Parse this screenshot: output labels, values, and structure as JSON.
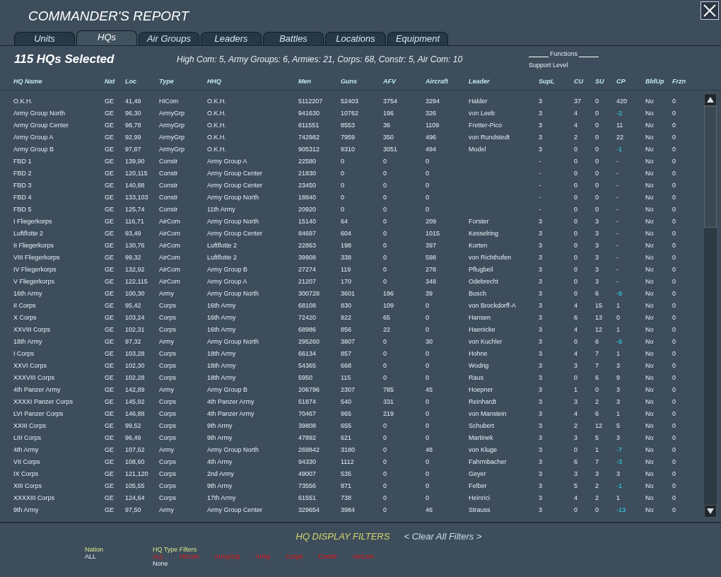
{
  "window": {
    "title": "COMMANDER'S REPORT"
  },
  "tabs": [
    {
      "label": "Units",
      "selected": false
    },
    {
      "label": "HQs",
      "selected": true
    },
    {
      "label": "Air Groups",
      "selected": false
    },
    {
      "label": "Leaders",
      "selected": false
    },
    {
      "label": "Battles",
      "selected": false
    },
    {
      "label": "Locations",
      "selected": false
    },
    {
      "label": "Equipment",
      "selected": false
    }
  ],
  "summary": {
    "count": "115 HQs Selected",
    "breakdown": "High Com: 5, Army Groups: 6, Armies: 21, Corps: 68, Constr: 5, Air Com: 10",
    "functions": "Functions",
    "support_level": "Support Level"
  },
  "table": {
    "columns": [
      "HQ Name",
      "Nat",
      "Loc",
      "Type",
      "HHQ",
      "Men",
      "Guns",
      "AFV",
      "Aircraft",
      "Leader",
      "SupL",
      "CU",
      "SU",
      "CP",
      "BldUp",
      "Frzn"
    ],
    "rows": [
      {
        "cells": [
          "O.K.H.",
          "GE",
          "41,49",
          "HiCom",
          "O.K.H.",
          "5112207",
          "52403",
          "3754",
          "3294",
          "Halder",
          "3",
          "37",
          "0",
          "420",
          "No",
          "0"
        ],
        "cp_alert": false
      },
      {
        "cells": [
          "Army Group North",
          "GE",
          "96,30",
          "ArmyGrp",
          "O.K.H.",
          "941630",
          "10762",
          "196",
          "326",
          "von Leeb",
          "3",
          "4",
          "0",
          "-2",
          "No",
          "0"
        ],
        "cp_alert": true
      },
      {
        "cells": [
          "Army Group Center",
          "GE",
          "98,78",
          "ArmyGrp",
          "O.K.H.",
          "811551",
          "8553",
          "36",
          "1109",
          "Fretter-Pico",
          "3",
          "4",
          "0",
          "11",
          "No",
          "0"
        ],
        "cp_alert": false
      },
      {
        "cells": [
          "Army Group A",
          "GE",
          "92,99",
          "ArmyGrp",
          "O.K.H.",
          "742982",
          "7959",
          "350",
          "496",
          "von Rundstedt",
          "3",
          "2",
          "0",
          "22",
          "No",
          "0"
        ],
        "cp_alert": false
      },
      {
        "cells": [
          "Army Group B",
          "GE",
          "97,87",
          "ArmyGrp",
          "O.K.H.",
          "905312",
          "9310",
          "3051",
          "494",
          "Model",
          "3",
          "0",
          "0",
          "-1",
          "No",
          "0"
        ],
        "cp_alert": true
      },
      {
        "cells": [
          "FBD 1",
          "GE",
          "139,90",
          "Constr",
          "Army Group A",
          "22580",
          "0",
          "0",
          "0",
          "",
          "-",
          "0",
          "0",
          "-",
          "No",
          "0"
        ],
        "cp_alert": false
      },
      {
        "cells": [
          "FBD 2",
          "GE",
          "120,115",
          "Constr",
          "Army Group Center",
          "21830",
          "0",
          "0",
          "0",
          "",
          "-",
          "0",
          "0",
          "-",
          "No",
          "0"
        ],
        "cp_alert": false
      },
      {
        "cells": [
          "FBD 3",
          "GE",
          "140,88",
          "Constr",
          "Army Group Center",
          "23450",
          "0",
          "0",
          "0",
          "",
          "-",
          "0",
          "0",
          "-",
          "No",
          "0"
        ],
        "cp_alert": false
      },
      {
        "cells": [
          "FBD 4",
          "GE",
          "133,103",
          "Constr",
          "Army Group North",
          "18840",
          "0",
          "0",
          "0",
          "",
          "-",
          "0",
          "0",
          "-",
          "No",
          "0"
        ],
        "cp_alert": false
      },
      {
        "cells": [
          "FBD 5",
          "GE",
          "125,74",
          "Constr",
          "11th Army",
          "20920",
          "0",
          "0",
          "0",
          "",
          "-",
          "0",
          "0",
          "-",
          "No",
          "0"
        ],
        "cp_alert": false
      },
      {
        "cells": [
          "I Fliegerkorps",
          "GE",
          "116,71",
          "AirCom",
          "Army Group North",
          "15140",
          "64",
          "0",
          "209",
          "Forster",
          "3",
          "0",
          "3",
          "-",
          "No",
          "0"
        ],
        "cp_alert": false
      },
      {
        "cells": [
          "Luftflotte 2",
          "GE",
          "93,49",
          "AirCom",
          "Army Group Center",
          "84697",
          "604",
          "0",
          "1015",
          "Kesselring",
          "3",
          "0",
          "3",
          "-",
          "No",
          "0"
        ],
        "cp_alert": false
      },
      {
        "cells": [
          "II Fliegerkorps",
          "GE",
          "130,76",
          "AirCom",
          "Luftflotte 2",
          "22863",
          "198",
          "0",
          "397",
          "Korten",
          "3",
          "0",
          "3",
          "-",
          "No",
          "0"
        ],
        "cp_alert": false
      },
      {
        "cells": [
          "VIII Fliegerkorps",
          "GE",
          "99,32",
          "AirCom",
          "Luftflotte 2",
          "39908",
          "338",
          "0",
          "598",
          "von Richthofen",
          "3",
          "0",
          "3",
          "-",
          "No",
          "0"
        ],
        "cp_alert": false
      },
      {
        "cells": [
          "IV Fliegerkorps",
          "GE",
          "132,92",
          "AirCom",
          "Army Group B",
          "27274",
          "119",
          "0",
          "278",
          "Pflugbeil",
          "3",
          "0",
          "3",
          "-",
          "No",
          "0"
        ],
        "cp_alert": false
      },
      {
        "cells": [
          "V Fliegerkorps",
          "GE",
          "122,115",
          "AirCom",
          "Army Group A",
          "21207",
          "170",
          "0",
          "348",
          "Odebrecht",
          "3",
          "0",
          "3",
          "-",
          "No",
          "0"
        ],
        "cp_alert": false
      },
      {
        "cells": [
          "16th Army",
          "GE",
          "100,30",
          "Army",
          "Army Group North",
          "300728",
          "3601",
          "196",
          "39",
          "Busch",
          "3",
          "0",
          "6",
          "-9",
          "No",
          "0"
        ],
        "cp_alert": true
      },
      {
        "cells": [
          "II Corps",
          "GE",
          "95,42",
          "Corps",
          "16th Army",
          "68108",
          "830",
          "109",
          "0",
          "von Brockdorff-A",
          "3",
          "4",
          "15",
          "1",
          "No",
          "0"
        ],
        "cp_alert": false
      },
      {
        "cells": [
          "X Corps",
          "GE",
          "103,24",
          "Corps",
          "16th Army",
          "72420",
          "922",
          "65",
          "0",
          "Hansen",
          "3",
          "6",
          "13",
          "0",
          "No",
          "0"
        ],
        "cp_alert": false
      },
      {
        "cells": [
          "XXVIII Corps",
          "GE",
          "102,31",
          "Corps",
          "16th Army",
          "68986",
          "856",
          "22",
          "0",
          "Haenicke",
          "3",
          "4",
          "12",
          "1",
          "No",
          "0"
        ],
        "cp_alert": false
      },
      {
        "cells": [
          "18th Army",
          "GE",
          "97,32",
          "Army",
          "Army Group North",
          "295260",
          "3807",
          "0",
          "30",
          "von Kuchler",
          "3",
          "0",
          "6",
          "-6",
          "No",
          "0"
        ],
        "cp_alert": true
      },
      {
        "cells": [
          "I Corps",
          "GE",
          "103,28",
          "Corps",
          "18th Army",
          "66134",
          "857",
          "0",
          "0",
          "Hohne",
          "3",
          "4",
          "7",
          "1",
          "No",
          "0"
        ],
        "cp_alert": false
      },
      {
        "cells": [
          "XXVI Corps",
          "GE",
          "102,30",
          "Corps",
          "18th Army",
          "54365",
          "668",
          "0",
          "0",
          "Wodrig",
          "3",
          "3",
          "7",
          "3",
          "No",
          "0"
        ],
        "cp_alert": false
      },
      {
        "cells": [
          "XXXVIII Corps",
          "GE",
          "102,28",
          "Corps",
          "18th Army",
          "5950",
          "115",
          "0",
          "0",
          "Raus",
          "3",
          "0",
          "6",
          "9",
          "No",
          "0"
        ],
        "cp_alert": false
      },
      {
        "cells": [
          "4th Panzer Army",
          "GE",
          "142,89",
          "Army",
          "Army Group B",
          "206796",
          "2307",
          "785",
          "45",
          "Hoepner",
          "3",
          "1",
          "0",
          "3",
          "No",
          "0"
        ],
        "cp_alert": false
      },
      {
        "cells": [
          "XXXXI Panzer Corps",
          "GE",
          "145,92",
          "Corps",
          "4th Panzer Army",
          "51874",
          "540",
          "331",
          "0",
          "Reinhardt",
          "3",
          "3",
          "2",
          "3",
          "No",
          "0"
        ],
        "cp_alert": false
      },
      {
        "cells": [
          "LVI Panzer Corps",
          "GE",
          "146,88",
          "Corps",
          "4th Panzer Army",
          "70467",
          "965",
          "219",
          "0",
          "von Manstein",
          "3",
          "4",
          "6",
          "1",
          "No",
          "0"
        ],
        "cp_alert": false
      },
      {
        "cells": [
          "XXIII Corps",
          "GE",
          "99,52",
          "Corps",
          "9th Army",
          "39808",
          "655",
          "0",
          "0",
          "Schubert",
          "3",
          "2",
          "12",
          "5",
          "No",
          "0"
        ],
        "cp_alert": false
      },
      {
        "cells": [
          "LIII Corps",
          "GE",
          "96,49",
          "Corps",
          "9th Army",
          "47892",
          "621",
          "0",
          "0",
          "Martinek",
          "3",
          "3",
          "5",
          "3",
          "No",
          "0"
        ],
        "cp_alert": false
      },
      {
        "cells": [
          "4th Army",
          "GE",
          "107,62",
          "Army",
          "Army Group North",
          "269842",
          "3180",
          "0",
          "48",
          "von Kluge",
          "3",
          "0",
          "1",
          "-7",
          "No",
          "0"
        ],
        "cp_alert": true
      },
      {
        "cells": [
          "VII Corps",
          "GE",
          "108,60",
          "Corps",
          "4th Army",
          "94330",
          "1112",
          "0",
          "0",
          "Fahrmbacher",
          "3",
          "6",
          "7",
          "-3",
          "No",
          "0"
        ],
        "cp_alert": true
      },
      {
        "cells": [
          "IX Corps",
          "GE",
          "121,120",
          "Corps",
          "2nd Army",
          "49007",
          "535",
          "0",
          "0",
          "Geyer",
          "3",
          "3",
          "3",
          "3",
          "No",
          "0"
        ],
        "cp_alert": false
      },
      {
        "cells": [
          "XIII Corps",
          "GE",
          "105,55",
          "Corps",
          "9th Army",
          "73556",
          "871",
          "0",
          "0",
          "Felber",
          "3",
          "5",
          "2",
          "-1",
          "No",
          "0"
        ],
        "cp_alert": true
      },
      {
        "cells": [
          "XXXXIII Corps",
          "GE",
          "124,64",
          "Corps",
          "17th Army",
          "61551",
          "738",
          "0",
          "0",
          "Heinrici",
          "3",
          "4",
          "2",
          "1",
          "No",
          "0"
        ],
        "cp_alert": false
      },
      {
        "cells": [
          "9th Army",
          "GE",
          "97,50",
          "Army",
          "Army Group Center",
          "329654",
          "3984",
          "0",
          "46",
          "Strauss",
          "3",
          "0",
          "0",
          "-13",
          "No",
          "0"
        ],
        "cp_alert": true
      }
    ]
  },
  "filters": {
    "title": "HQ DISPLAY FILTERS",
    "clear": "< Clear All Filters >",
    "nation_label": "Nation",
    "nation_value": "ALL",
    "type_label": "HQ  Type  Filters",
    "types": [
      {
        "label": "ALL",
        "on": true
      },
      {
        "label": "HiCom",
        "on": true
      },
      {
        "label": "ArmyGrp",
        "on": true
      },
      {
        "label": "Army",
        "on": true
      },
      {
        "label": "Corps",
        "on": true
      },
      {
        "label": "Constr",
        "on": true
      },
      {
        "label": "AirCom",
        "on": true
      }
    ],
    "none": "None"
  }
}
